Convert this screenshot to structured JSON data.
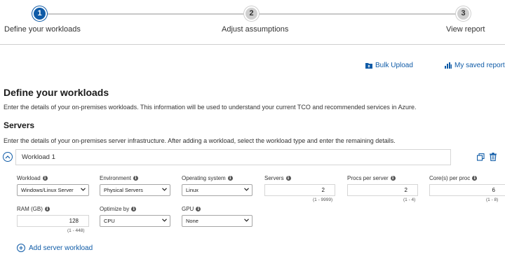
{
  "stepper": {
    "steps": [
      {
        "number": "1",
        "label": "Define your workloads"
      },
      {
        "number": "2",
        "label": "Adjust assumptions"
      },
      {
        "number": "3",
        "label": "View report"
      }
    ],
    "active_step": 1
  },
  "toolbar": {
    "bulk_upload": "Bulk Upload",
    "saved_reports": "My saved reports"
  },
  "page": {
    "title": "Define your workloads",
    "description": "Enter the details of your on-premises workloads. This information will be used to understand your current TCO and recommended services in Azure."
  },
  "servers": {
    "title": "Servers",
    "description": "Enter the details of your on-premises server infrastructure. After adding a workload, select the workload type and enter the remaining details."
  },
  "workload": {
    "name": "Workload 1",
    "fields": {
      "workload": {
        "label": "Workload",
        "value": "Windows/Linux Server"
      },
      "environment": {
        "label": "Environment",
        "value": "Physical Servers"
      },
      "operating_system": {
        "label": "Operating system",
        "value": "Linux"
      },
      "servers": {
        "label": "Servers",
        "value": "2",
        "range": "(1 - 9999)"
      },
      "procs_per_server": {
        "label": "Procs per server",
        "value": "2",
        "range": "(1 - 4)"
      },
      "cores_per_proc": {
        "label": "Core(s) per proc",
        "value": "6",
        "range": "(1 - 8)"
      },
      "ram": {
        "label": "RAM (GB)",
        "value": "128",
        "range": "(1 - 448)"
      },
      "optimize_by": {
        "label": "Optimize by",
        "value": "CPU"
      },
      "gpu": {
        "label": "GPU",
        "value": "None"
      }
    }
  },
  "add_server_workload": "Add server workload",
  "colors": {
    "accent": "#0f5ba7",
    "inactive_step": "#cfcfcf"
  },
  "icons": {
    "bulk_upload": "folder-upload-icon",
    "saved_reports": "bar-chart-icon",
    "copy": "copy-icon",
    "delete": "trash-icon",
    "collapse": "chevron-up-icon",
    "info": "info-icon",
    "add": "plus-circle-icon"
  }
}
